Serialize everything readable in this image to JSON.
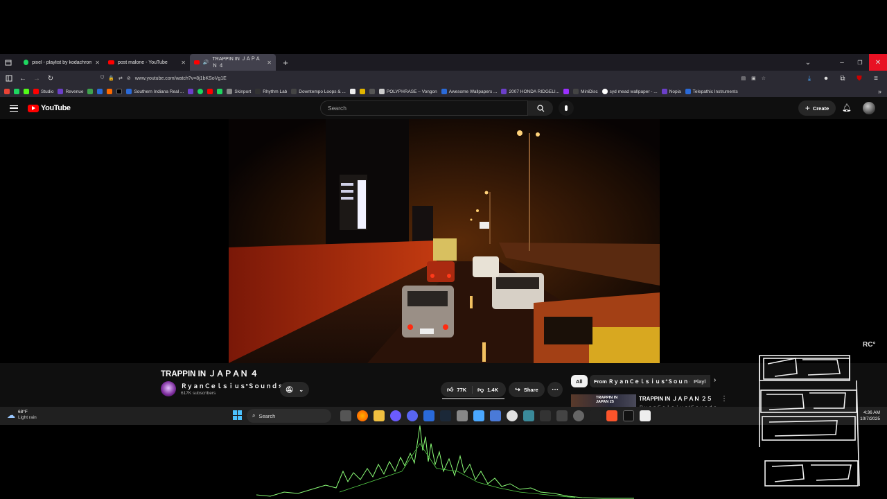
{
  "browser": {
    "tabs": [
      {
        "label": "pixel - playlist by kodachrome!!",
        "icon_color": "#1ed760"
      },
      {
        "label": "post malone - YouTube",
        "icon_color": "#ff0000"
      },
      {
        "label": "TRAPPIN IN ＪＡＰＡＮ ４",
        "icon_color": "#ff0000"
      }
    ],
    "url": "www.youtube.com/watch?v=8j1bKSoVg1E",
    "bookmarks": [
      {
        "label": "Studio",
        "color": "#ff0000"
      },
      {
        "label": "Revenue",
        "color": "#6b3fc9"
      },
      {
        "label": "Southern Indiana Real ...",
        "color": "#2a6ad8"
      },
      {
        "label": "Skinport",
        "color": "#888888"
      },
      {
        "label": "Rhythm Lab",
        "color": "#333333"
      },
      {
        "label": "Downtempo Loops & ...",
        "color": "#444444"
      },
      {
        "label": "POLYPHRASE – Vongon",
        "color": "#cccccc"
      },
      {
        "label": "Awesome Wallpapers ...",
        "color": "#2a6ad8"
      },
      {
        "label": "2007 HONDA RIDGELI...",
        "color": "#6b3fc9"
      },
      {
        "label": "MiniDisc",
        "color": "#444444"
      },
      {
        "label": "syd mead wallpaper - ...",
        "color": "#ffffff"
      },
      {
        "label": "Nopia",
        "color": "#6b3fc9"
      },
      {
        "label": "Telepathic Instruments",
        "color": "#2a6ad8"
      }
    ]
  },
  "youtube": {
    "logo_text": "YouTube",
    "search_placeholder": "Search",
    "create_label": "Create",
    "video_title": "TRAPPIN IN ＪＡＰＡＮ ４",
    "channel_name": "ＲｙａｎＣｅｌｓｉｕｓ°Ｓｏｕｎｄｓ",
    "subscribers": "617K subscribers",
    "likes": "77K",
    "dislikes": "1.4K",
    "share_label": "Share",
    "chips": [
      "All",
      "From ＲｙａｎＣｅｌｓｉｕｓ°Ｓｏｕｎｄｓ",
      "Playl"
    ],
    "up_next_title": "TRAPPIN IN ＪＡＰＡＮ ２５",
    "up_next_channel": "ＲｙａｎＣｅｌｓｉｕｓ°Ｓｏｕｎｄｓ",
    "thumb_overlay": "TRAPPIN IN JAPAN 25"
  },
  "taskbar": {
    "weather_temp": "68°F",
    "weather_desc": "Light rain",
    "search_label": "Search",
    "time": "4:36 AM",
    "date": "10/7/2025"
  },
  "overlay": {
    "watermark": "RC°"
  },
  "icons": {
    "tab_icon": "tab-list-icon",
    "back": "back-arrow-icon",
    "forward": "forward-arrow-icon",
    "reload": "reload-icon",
    "menu": "hamburger-menu-icon",
    "bell": "bell-icon",
    "mic": "microphone-icon"
  },
  "colors": {
    "youtube_red": "#ff0000",
    "visualizer_green": "#7cff6a",
    "close_red": "#e81123"
  }
}
